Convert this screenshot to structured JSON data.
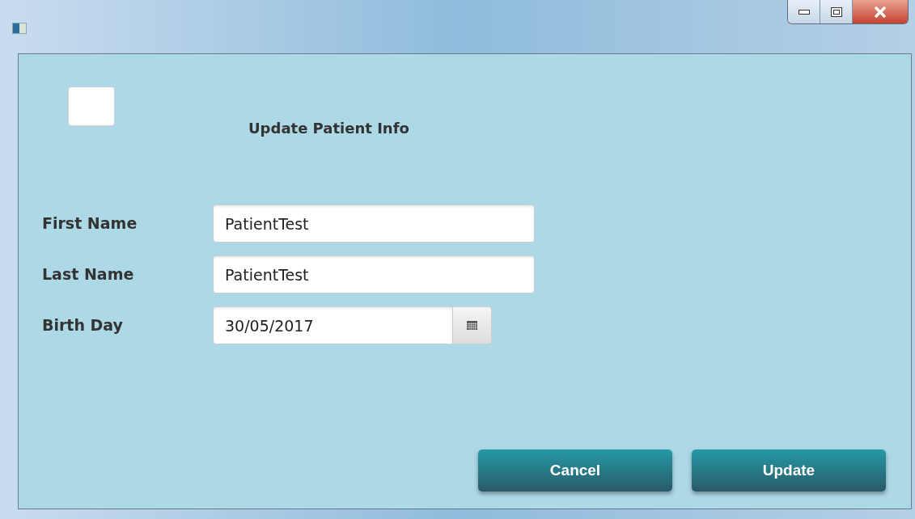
{
  "heading": "Update Patient Info",
  "fields": [
    {
      "kind": "text",
      "label": "First Name",
      "value": "PatientTest"
    },
    {
      "kind": "text",
      "label": "Last Name",
      "value": "PatientTest"
    },
    {
      "kind": "date",
      "label": "Birth Day",
      "value": "30/05/2017"
    }
  ],
  "buttons": [
    "Cancel",
    "Update"
  ]
}
